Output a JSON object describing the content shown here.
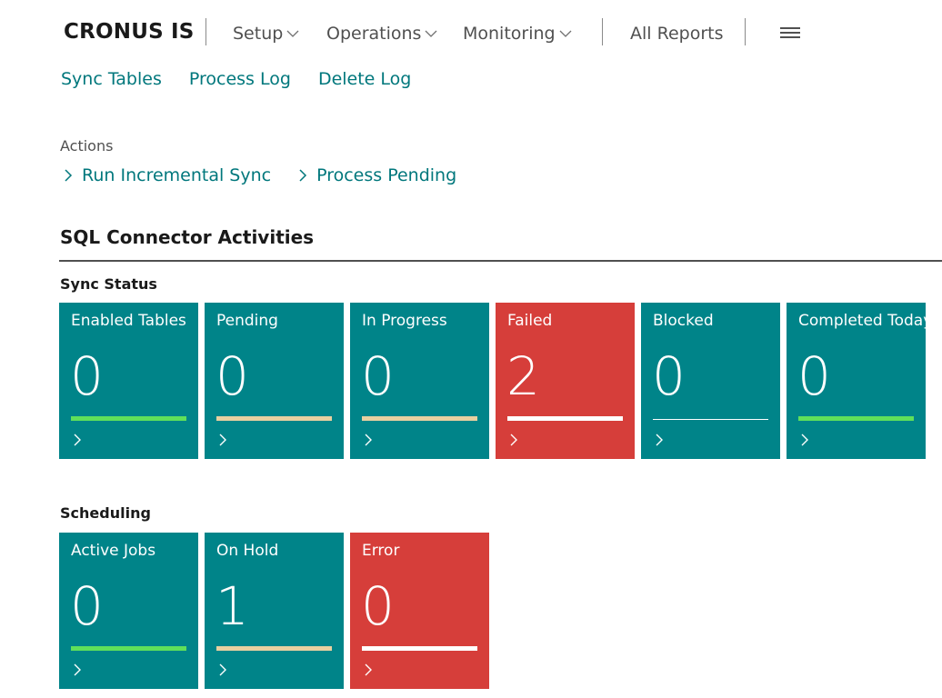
{
  "header": {
    "company": "CRONUS IS",
    "menus": [
      {
        "label": "Setup"
      },
      {
        "label": "Operations"
      },
      {
        "label": "Monitoring"
      }
    ],
    "all_reports": "All Reports"
  },
  "subnav": [
    "Sync Tables",
    "Process Log",
    "Delete Log"
  ],
  "actions": {
    "label": "Actions",
    "items": [
      "Run Incremental Sync",
      "Process Pending"
    ]
  },
  "section_title": "SQL Connector Activities",
  "groups": [
    {
      "title": "Sync Status",
      "tiles": [
        {
          "label": "Enabled Tables",
          "value": "0",
          "color": "#008489",
          "bar_color": "#5fe05a"
        },
        {
          "label": "Pending",
          "value": "0",
          "color": "#008489",
          "bar_color": "#e8d0a0"
        },
        {
          "label": "In Progress",
          "value": "0",
          "color": "#008489",
          "bar_color": "#e8d0a0"
        },
        {
          "label": "Failed",
          "value": "2",
          "color": "#d63e3a",
          "bar_color": "#ffffff"
        },
        {
          "label": "Blocked",
          "value": "0",
          "color": "#008489",
          "bar_color": "#ffffff"
        },
        {
          "label": "Completed Today",
          "value": "0",
          "color": "#008489",
          "bar_color": "#5fe05a"
        }
      ]
    },
    {
      "title": "Scheduling",
      "tiles": [
        {
          "label": "Active Jobs",
          "value": "0",
          "color": "#008489",
          "bar_color": "#5fe05a"
        },
        {
          "label": "On Hold",
          "value": "1",
          "color": "#008489",
          "bar_color": "#e8d0a0"
        },
        {
          "label": "Error",
          "value": "0",
          "color": "#d63e3a",
          "bar_color": "#ffffff"
        }
      ]
    }
  ]
}
